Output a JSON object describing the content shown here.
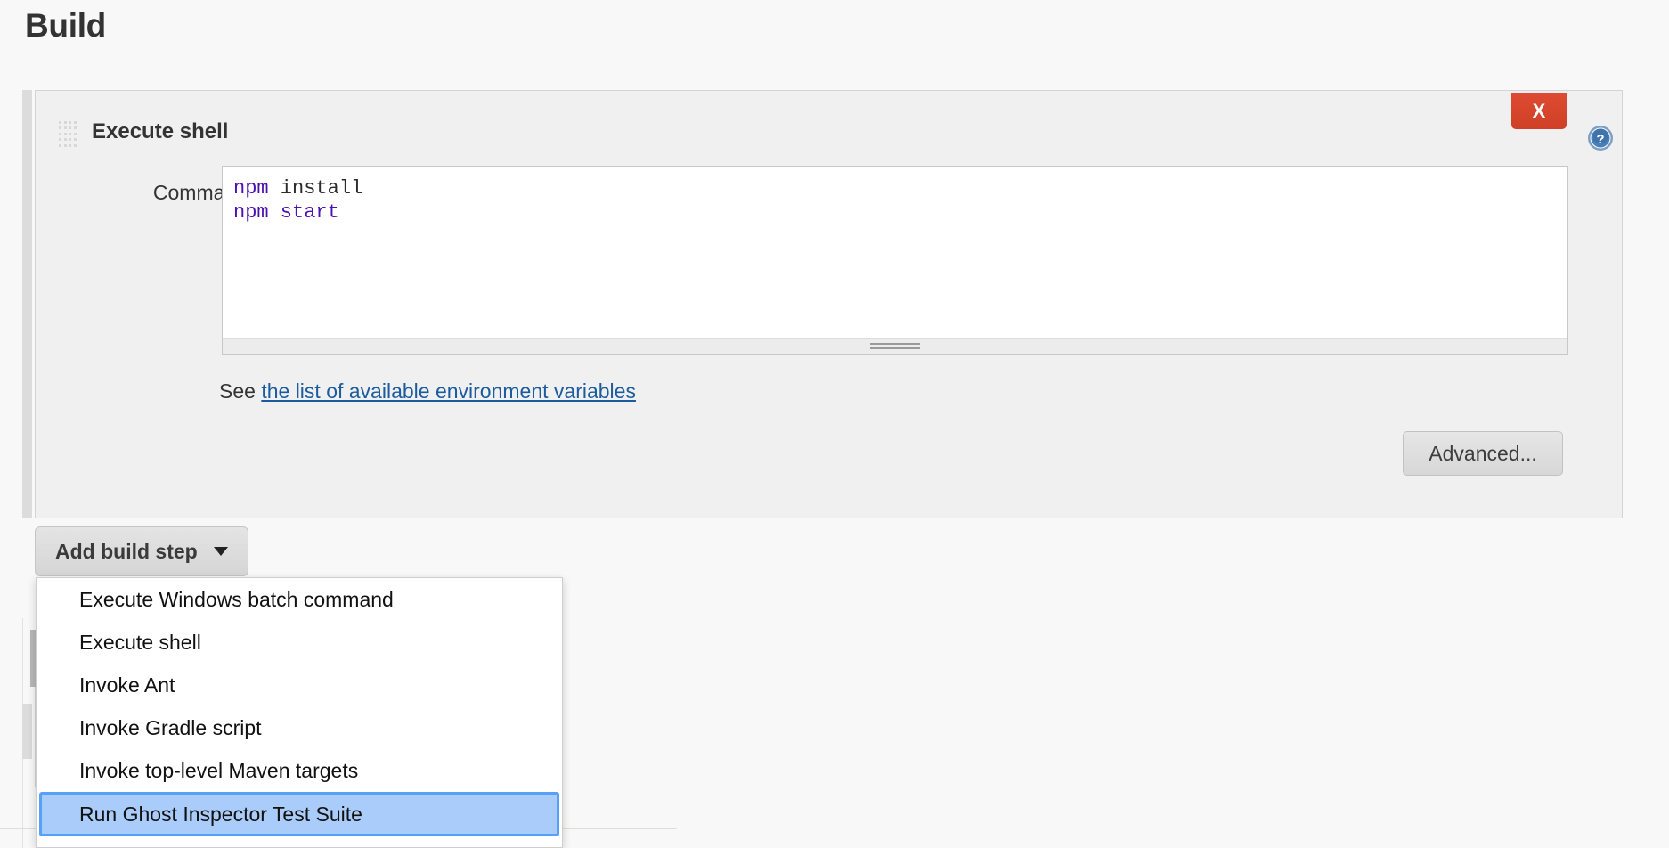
{
  "page": {
    "title": "Build"
  },
  "build_step": {
    "name": "Execute shell",
    "drag_handle_icon": "drag-dots-icon",
    "delete_label": "X",
    "help_icon": "help-question-icon",
    "command": {
      "label": "Command",
      "lines": [
        {
          "cmd": "npm",
          "arg": " install",
          "arg_highlighted": false
        },
        {
          "cmd": "npm",
          "arg": " start",
          "arg_highlighted": true
        }
      ],
      "value": "npm install\nnpm start",
      "resize_grip_icon": "resize-grip-icon"
    },
    "help_text_prefix": "See ",
    "help_link_text": "the list of available environment variables",
    "advanced_label": "Advanced..."
  },
  "toolbar": {
    "add_build_step_label": "Add build step",
    "caret_icon": "chevron-down-icon"
  },
  "dropdown": {
    "items": [
      {
        "label": "Execute Windows batch command",
        "selected": false
      },
      {
        "label": "Execute shell",
        "selected": false
      },
      {
        "label": "Invoke Ant",
        "selected": false
      },
      {
        "label": "Invoke Gradle script",
        "selected": false
      },
      {
        "label": "Invoke top-level Maven targets",
        "selected": false
      },
      {
        "label": "Run Ghost Inspector Test Suite",
        "selected": true
      }
    ]
  },
  "colors": {
    "page_bg": "#f8f8f8",
    "panel_bg": "#f0f0f0",
    "delete_red": "#d44427",
    "link_blue": "#1c5c9e",
    "code_purple": "#4b12b0",
    "selection_blue": "#aaccfa",
    "selection_border": "#56a0f5"
  }
}
